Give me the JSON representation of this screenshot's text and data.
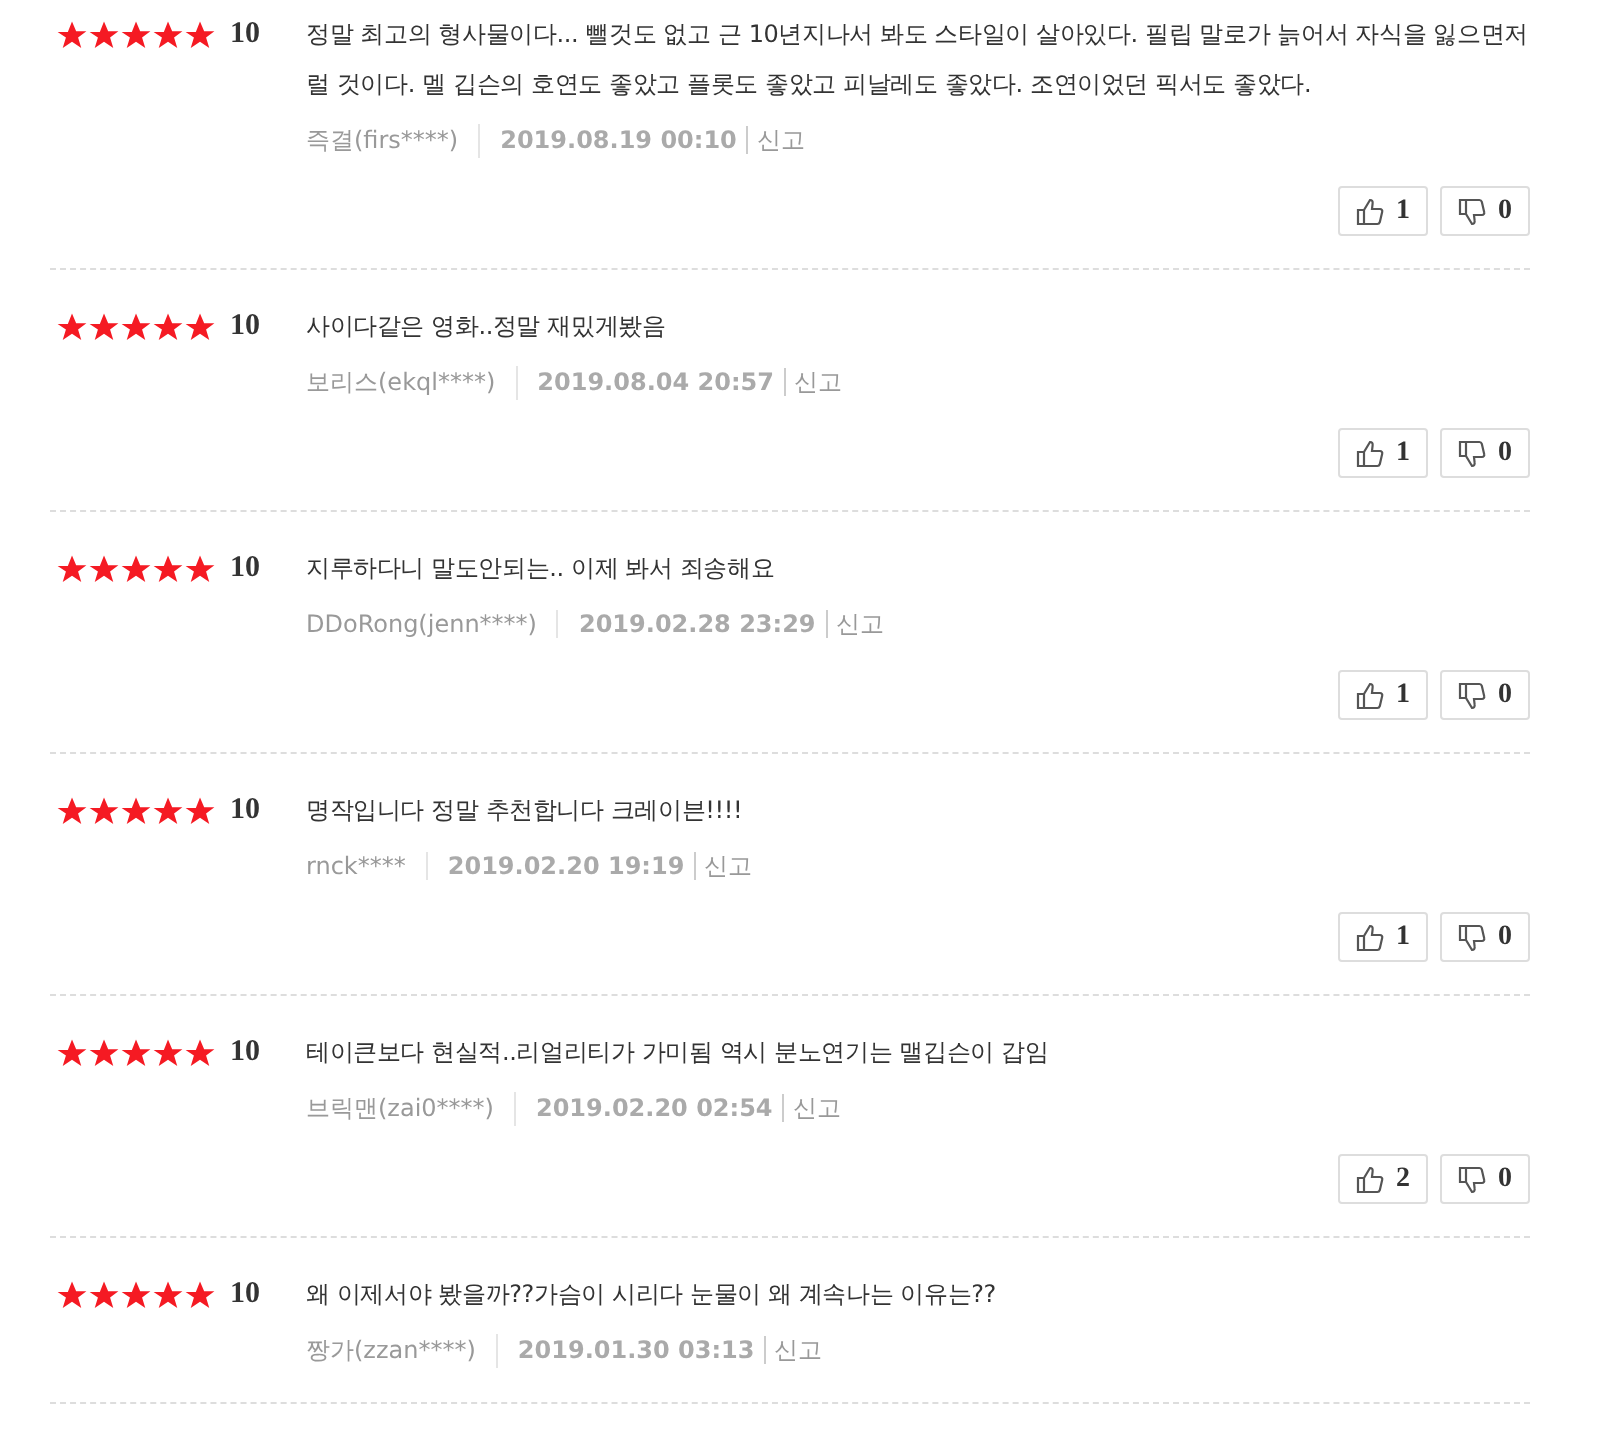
{
  "reviews": [
    {
      "stars": 5,
      "score": "10",
      "text": "정말 최고의 형사물이다... 뺄것도 없고 근 10년지나서 봐도 스타일이 살아있다. 필립 말로가 늙어서 자식을 잃으면저럴 것이다. 멜 깁슨의 호연도 좋았고 플롯도 좋았고 피날레도 좋았다. 조연이었던 픽서도 좋았다.",
      "author": "즉결(firs****)",
      "date": "2019.08.19 00:10",
      "report": "신고",
      "likes": "1",
      "dislikes": "0"
    },
    {
      "stars": 5,
      "score": "10",
      "text": "사이다같은 영화..정말 재밌게봤음",
      "author": "보리스(ekql****)",
      "date": "2019.08.04 20:57",
      "report": "신고",
      "likes": "1",
      "dislikes": "0"
    },
    {
      "stars": 5,
      "score": "10",
      "text": "지루하다니 말도안되는.. 이제 봐서 죄송해요",
      "author": "DDoRong(jenn****)",
      "date": "2019.02.28 23:29",
      "report": "신고",
      "likes": "1",
      "dislikes": "0"
    },
    {
      "stars": 5,
      "score": "10",
      "text": "명작입니다 정말 추천합니다 크레이븐!!!!",
      "author": "rnck****",
      "date": "2019.02.20 19:19",
      "report": "신고",
      "likes": "1",
      "dislikes": "0"
    },
    {
      "stars": 5,
      "score": "10",
      "text": "테이큰보다 현실적..리얼리티가 가미됨 역시 분노연기는 맬깁슨이 갑임",
      "author": "브릭맨(zai0****)",
      "date": "2019.02.20 02:54",
      "report": "신고",
      "likes": "2",
      "dislikes": "0"
    },
    {
      "stars": 5,
      "score": "10",
      "text": "왜 이제서야 봤을까??가슴이 시리다 눈물이 왜 계속나는 이유는??",
      "author": "짱가(zzan****)",
      "date": "2019.01.30 03:13",
      "report": "신고"
    }
  ]
}
